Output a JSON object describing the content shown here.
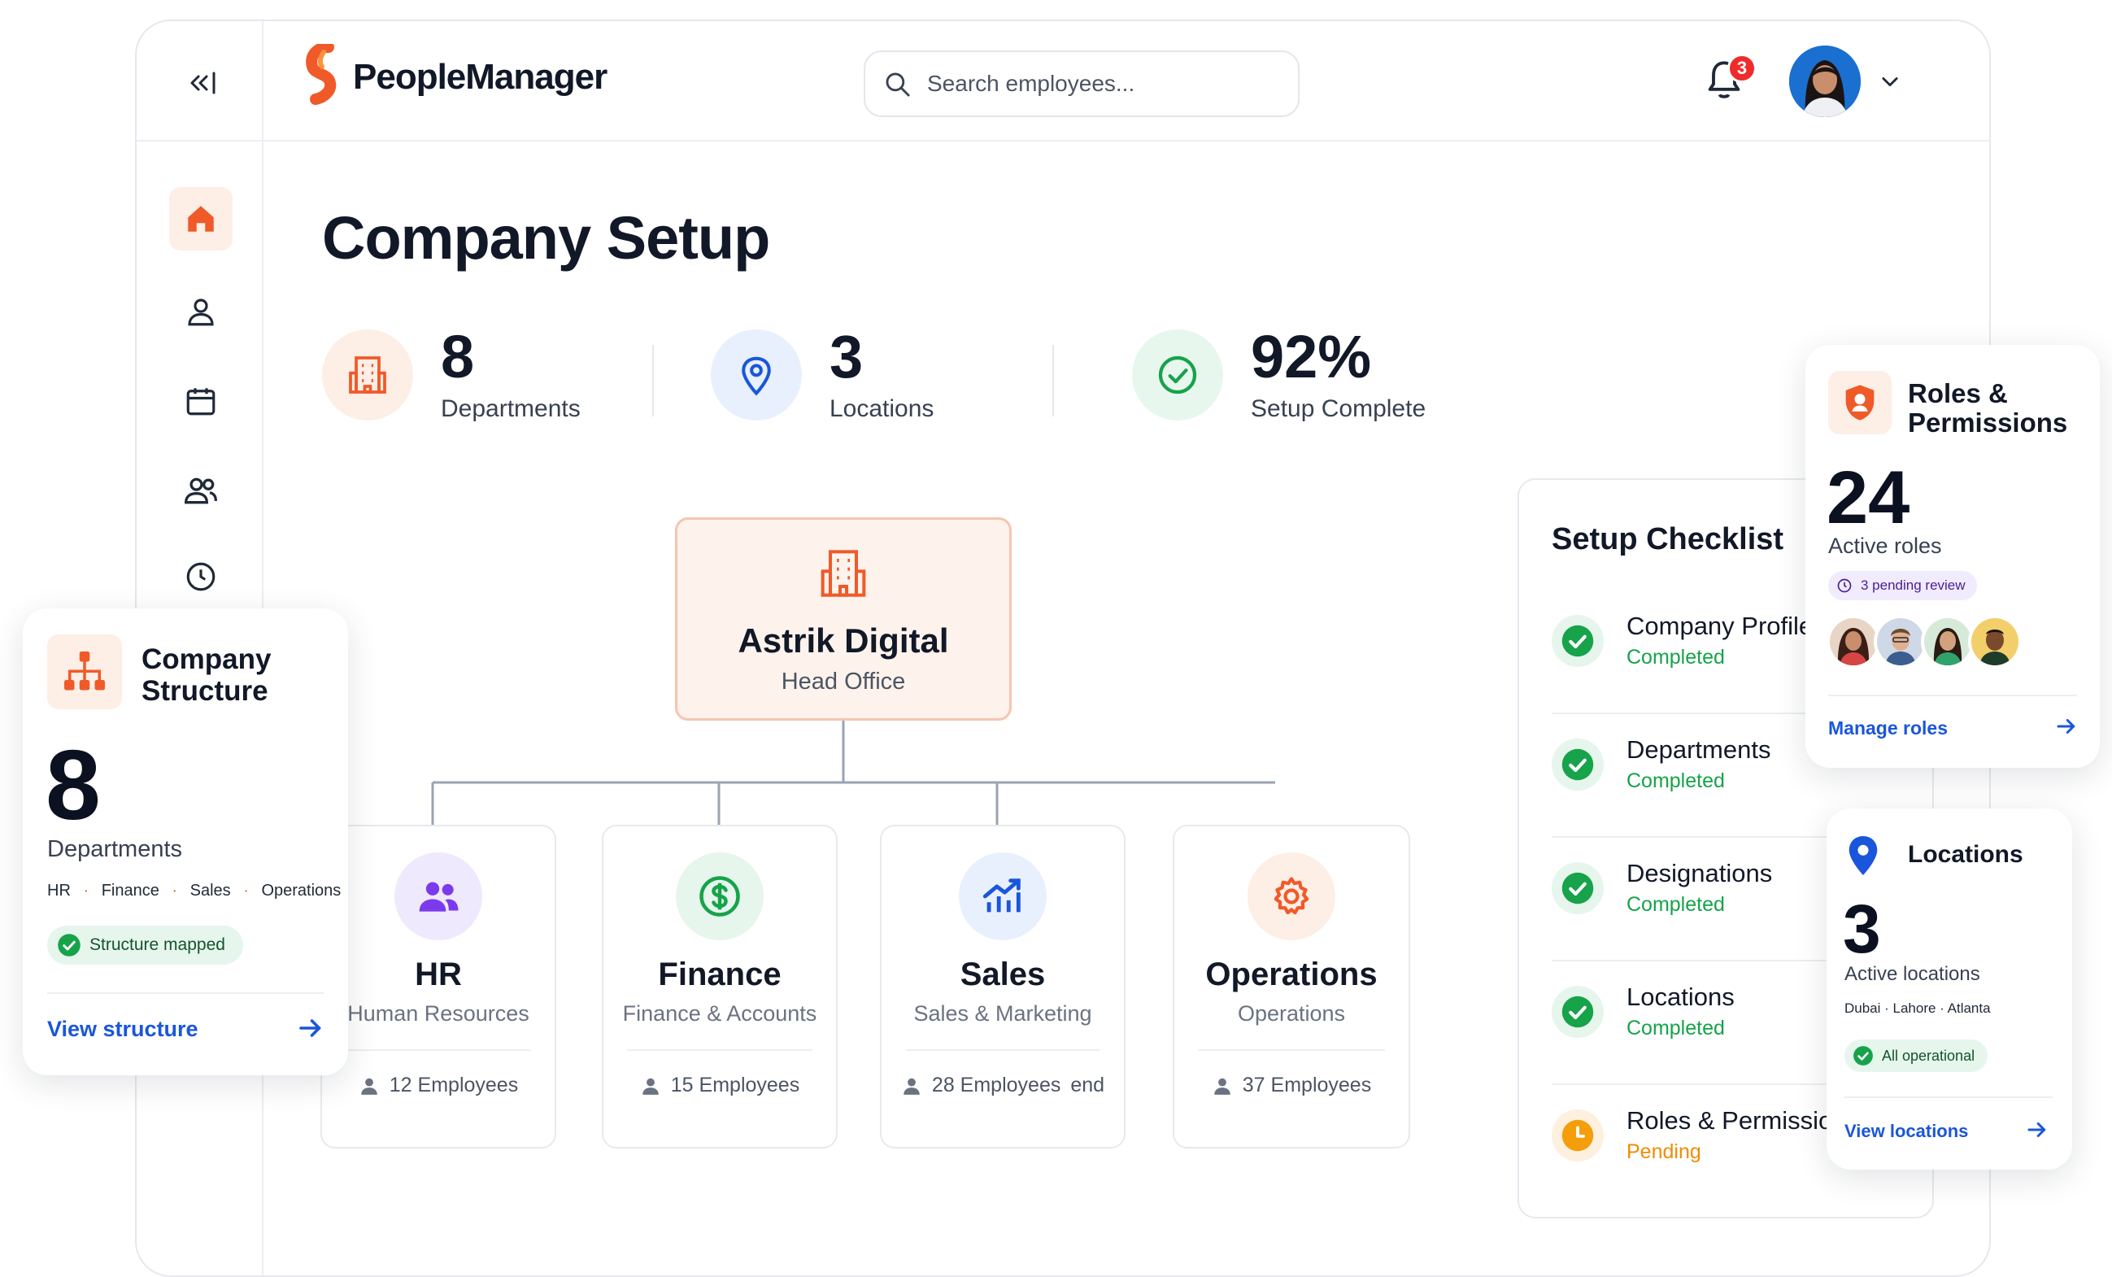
{
  "app": {
    "name": "PeopleManager"
  },
  "colors": {
    "accent": "#f05a28",
    "primary_link": "#1a56db",
    "success": "#16a34a",
    "pending": "#f59e0b"
  },
  "header": {
    "search": {
      "placeholder": "Search employees..."
    },
    "notifications": {
      "count": "3"
    }
  },
  "sidebar": {
    "items": [
      {
        "name": "home",
        "icon": "home-icon",
        "active": true
      },
      {
        "name": "profile",
        "icon": "user-icon"
      },
      {
        "name": "calendar",
        "icon": "calendar-icon"
      },
      {
        "name": "team",
        "icon": "users-icon"
      },
      {
        "name": "time",
        "icon": "clock-icon"
      }
    ]
  },
  "page": {
    "title": "Company Setup"
  },
  "stats": [
    {
      "value": "8",
      "label": "Departments",
      "icon": "building-icon"
    },
    {
      "value": "3",
      "label": "Locations",
      "icon": "map-pin-icon"
    },
    {
      "value": "92%",
      "label": "Setup Complete",
      "icon": "check-circle-icon"
    }
  ],
  "org": {
    "head": {
      "name": "Astrik Digital",
      "subtitle": "Head Office"
    },
    "departments": [
      {
        "name": "HR",
        "subtitle": "Human Resources",
        "employees": "12 Employees",
        "icon": "users-icon"
      },
      {
        "name": "Finance",
        "subtitle": "Finance & Accounts",
        "employees": "15 Employees",
        "icon": "dollar-icon"
      },
      {
        "name": "Sales",
        "subtitle": "Sales & Marketing",
        "employees": "28 Employees",
        "icon": "chart-up-icon"
      },
      {
        "name": "Operations",
        "subtitle": "Operations",
        "employees": "37 Employees",
        "icon": "gear-icon"
      }
    ]
  },
  "checklist": {
    "title": "Setup Checklist",
    "items": [
      {
        "name": "Company Profile",
        "status": "Completed"
      },
      {
        "name": "Departments",
        "status": "Completed"
      },
      {
        "name": "Designations",
        "status": "Completed"
      },
      {
        "name": "Locations",
        "status": "Completed"
      },
      {
        "name": "Roles & Permissions",
        "status": "Pending"
      }
    ]
  },
  "structure_card": {
    "title_line1": "Company",
    "title_line2": "Structure",
    "value": "8",
    "label": "Departments",
    "tags": [
      "HR",
      "Finance",
      "Sales",
      "Operations"
    ],
    "badge": "Structure mapped",
    "link": "View structure"
  },
  "roles_card": {
    "title_line1": "Roles &",
    "title_line2": "Permissions",
    "value": "24",
    "label": "Active roles",
    "badge": "3 pending review",
    "link": "Manage roles"
  },
  "locations_card": {
    "title": "Locations",
    "value": "3",
    "label": "Active locations",
    "cities": "Dubai · Lahore · Atlanta",
    "badge": "All operational",
    "link": "View locations"
  }
}
